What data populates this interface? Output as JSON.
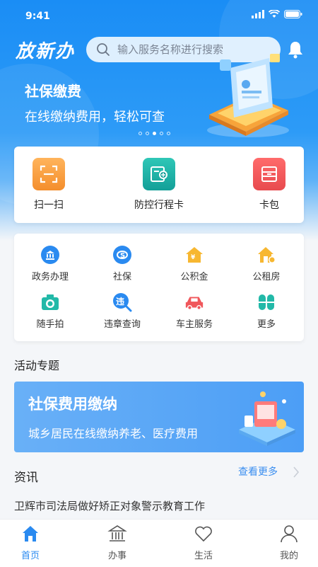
{
  "status_bar": {
    "time": "9:41"
  },
  "header": {
    "logo": "放新办",
    "search_placeholder": "输入服务名称进行搜索"
  },
  "banner": {
    "title": "社保缴费",
    "subtitle": "在线缴纳费用，轻松可查",
    "dots_count": 5,
    "active_dot": 2
  },
  "quick_actions": [
    {
      "label": "扫一扫",
      "icon": "scan-icon",
      "color": "#f7a54a"
    },
    {
      "label": "防控行程卡",
      "icon": "trip-card-icon",
      "color": "#1fb3a8"
    },
    {
      "label": "卡包",
      "icon": "card-wallet-icon",
      "color": "#f0575b"
    }
  ],
  "services": [
    {
      "label": "政务办理",
      "icon": "government-icon",
      "color": "#2a8af0"
    },
    {
      "label": "社保",
      "icon": "social-security-icon",
      "color": "#2a8af0"
    },
    {
      "label": "公积金",
      "icon": "housing-fund-icon",
      "color": "#f7b731"
    },
    {
      "label": "公租房",
      "icon": "public-housing-icon",
      "color": "#f7b731"
    },
    {
      "label": "随手拍",
      "icon": "camera-icon",
      "color": "#22b9a8"
    },
    {
      "label": "违章查询",
      "icon": "violation-icon",
      "color": "#2a8af0"
    },
    {
      "label": "车主服务",
      "icon": "car-icon",
      "color": "#f0575b"
    },
    {
      "label": "更多",
      "icon": "more-icon",
      "color": "#22b9a8"
    }
  ],
  "activity": {
    "section_title": "活动专题",
    "promo_title": "社保费用缴纳",
    "promo_subtitle": "城乡居民在线缴纳养老、医疗费用"
  },
  "news": {
    "section_title": "资讯",
    "more_label": "查看更多",
    "items": [
      "卫辉市司法局做好矫正对象警示教育工作"
    ]
  },
  "tabbar": [
    {
      "label": "首页",
      "icon": "home-icon",
      "active": true
    },
    {
      "label": "办事",
      "icon": "affairs-icon",
      "active": false
    },
    {
      "label": "生活",
      "icon": "heart-icon",
      "active": false
    },
    {
      "label": "我的",
      "icon": "profile-icon",
      "active": false
    }
  ],
  "colors": {
    "primary": "#2a8af0",
    "header_blue": "#1a8df5"
  }
}
